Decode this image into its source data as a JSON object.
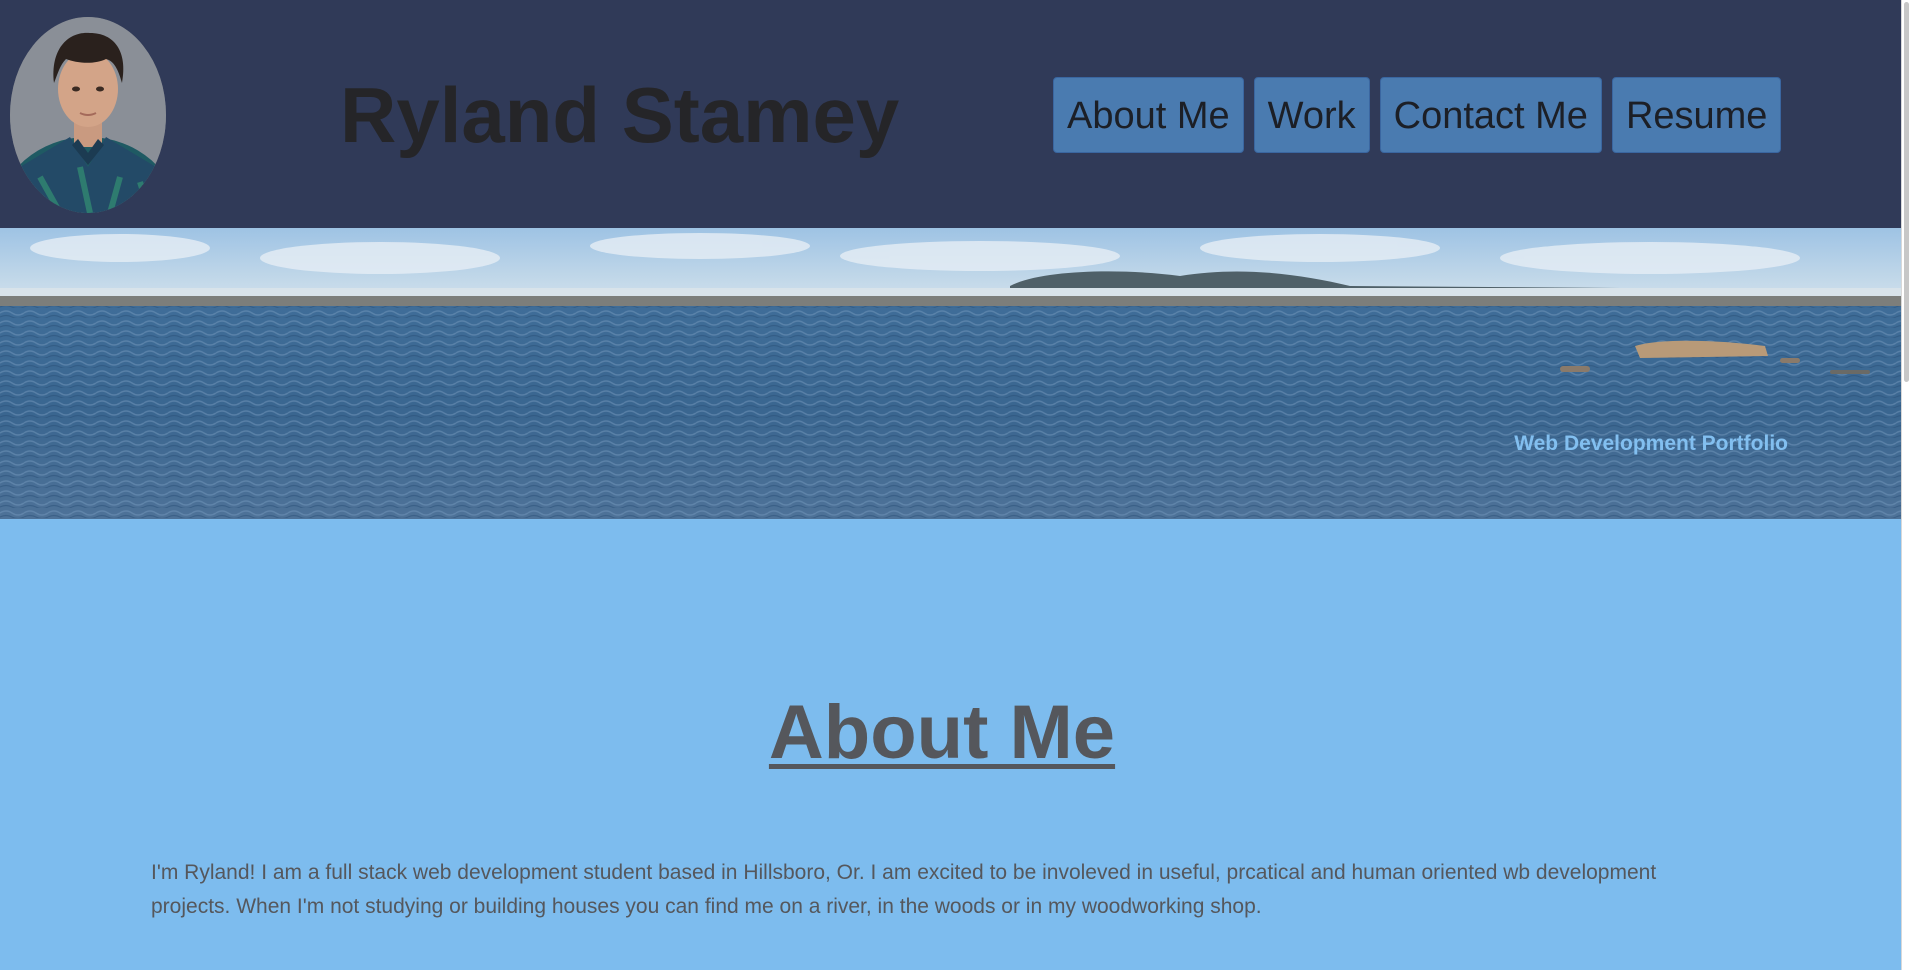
{
  "header": {
    "title": "Ryland Stamey",
    "avatar_icon": "portrait-photo",
    "nav": [
      {
        "label": "About Me"
      },
      {
        "label": "Work"
      },
      {
        "label": "Contact Me"
      },
      {
        "label": "Resume"
      }
    ]
  },
  "hero": {
    "caption": "Web Development Portfolio"
  },
  "about": {
    "heading": "About Me",
    "body": "I'm Ryland! I am a full stack web development student based in Hillsboro, Or. I am excited to be involeved in useful, prcatical and human oriented wb development projects. When I'm not studying or building houses you can find me on a river, in the woods or in my woodworking shop."
  },
  "colors": {
    "header_bg": "#303a58",
    "nav_button_bg": "#4a7bb0",
    "page_bg": "#7dbcee",
    "text": "#55575c"
  }
}
